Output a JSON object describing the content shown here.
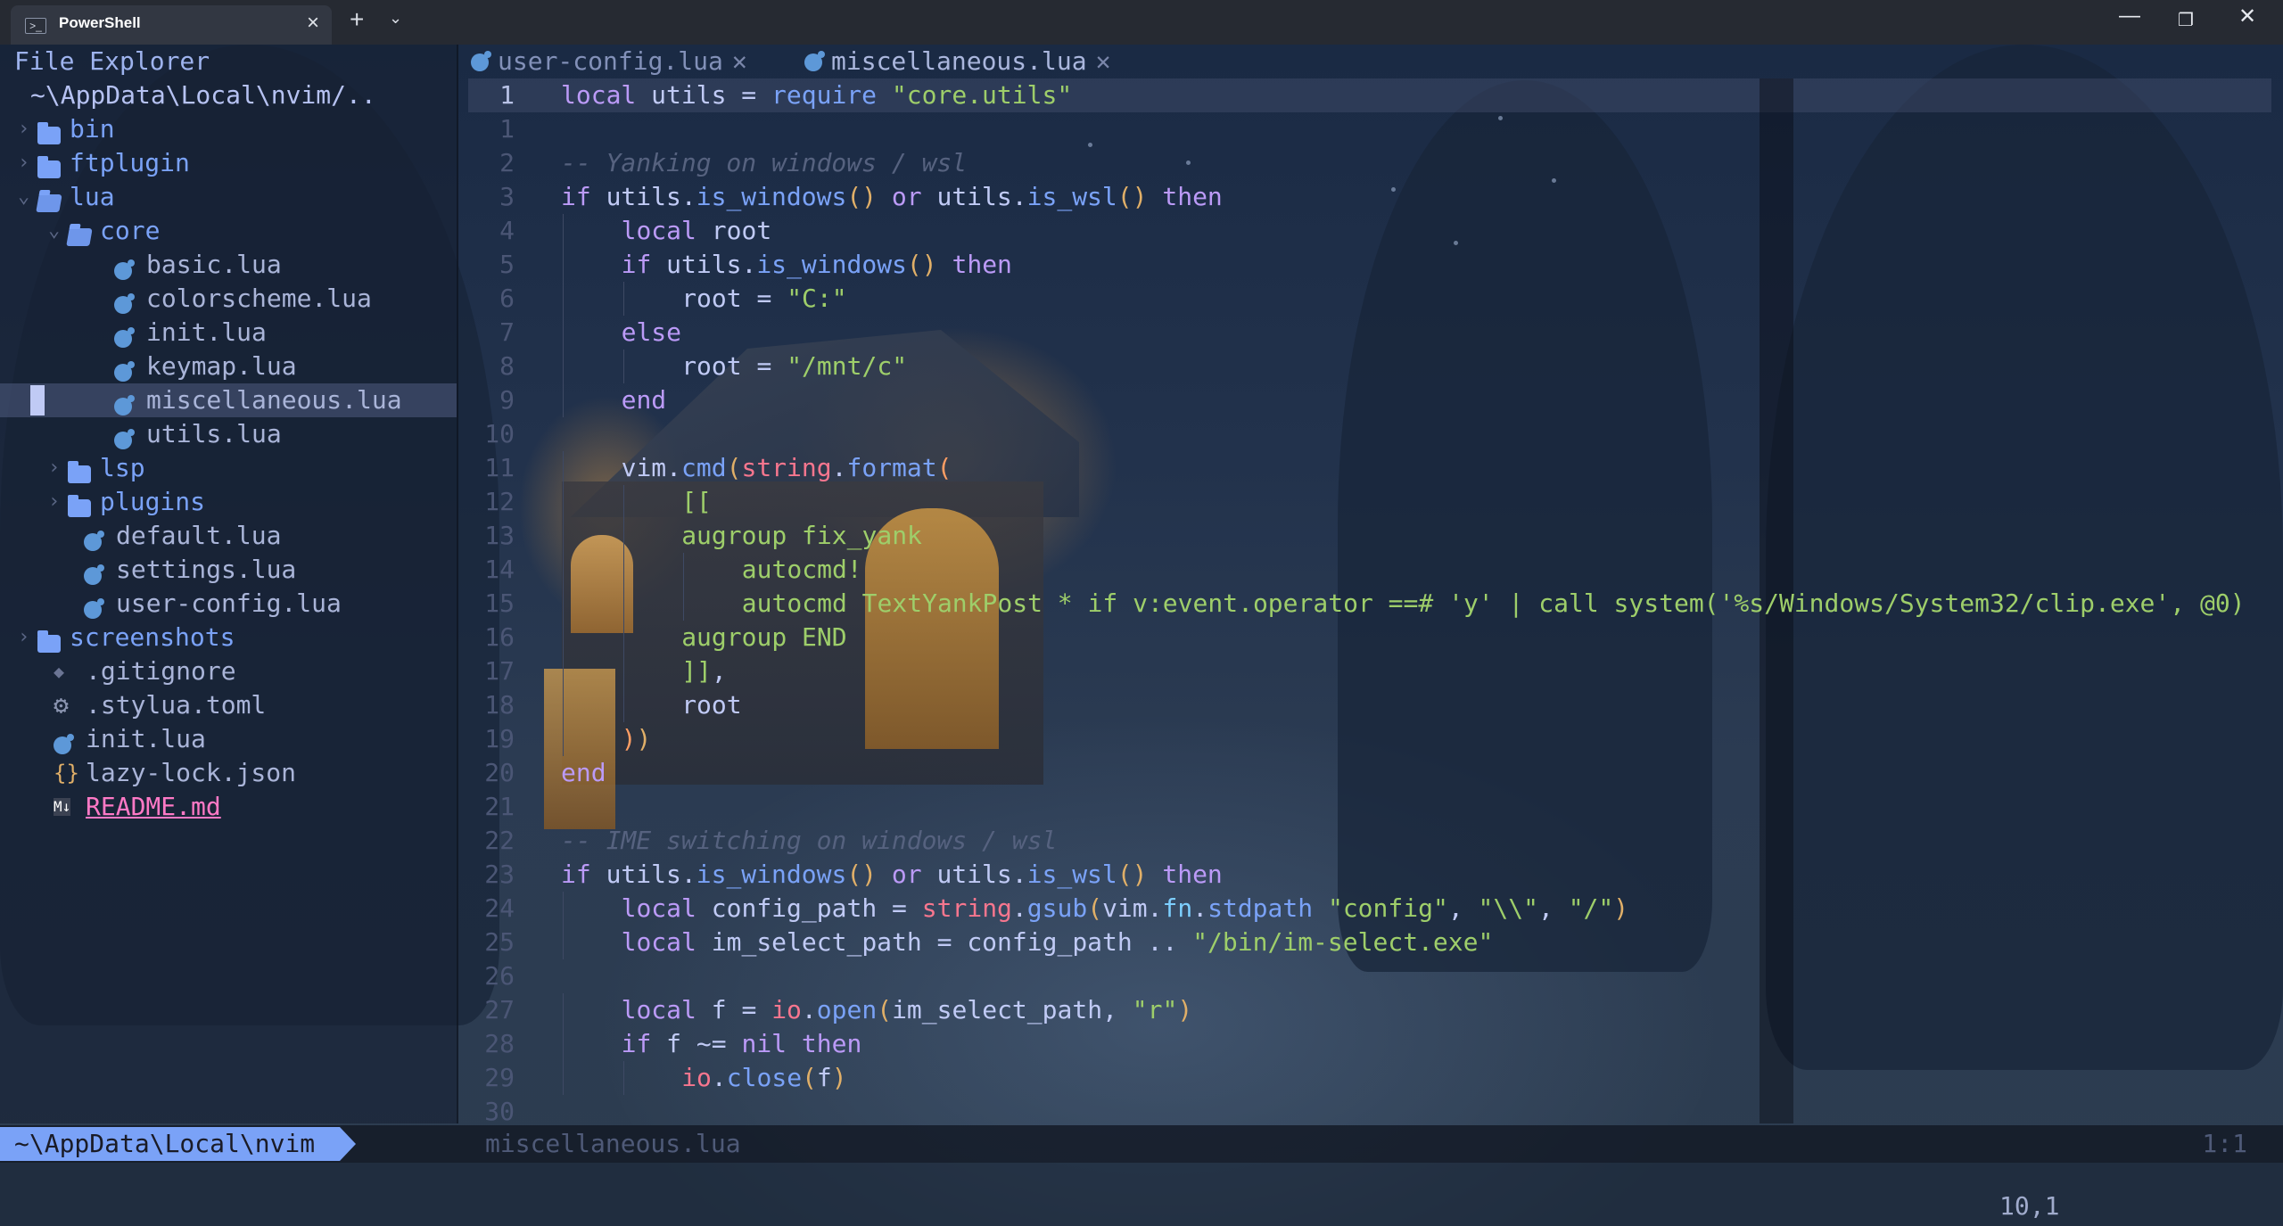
{
  "window": {
    "tab_title": "PowerShell",
    "tab_icon": "powershell-icon",
    "new_tab_label": "+",
    "dropdown_label": "⌄",
    "minimize_label": "—",
    "maximize_label": "❐",
    "close_label": "✕"
  },
  "explorer": {
    "title": "File Explorer",
    "root_path": "~\\AppData\\Local\\nvim/..",
    "items": [
      {
        "label": "bin",
        "type": "folder",
        "expanded": false,
        "depth": 0
      },
      {
        "label": "ftplugin",
        "type": "folder",
        "expanded": false,
        "depth": 0
      },
      {
        "label": "lua",
        "type": "folder",
        "expanded": true,
        "depth": 0
      },
      {
        "label": "core",
        "type": "folder",
        "expanded": true,
        "depth": 1
      },
      {
        "label": "basic.lua",
        "type": "lua",
        "depth": 2
      },
      {
        "label": "colorscheme.lua",
        "type": "lua",
        "depth": 2
      },
      {
        "label": "init.lua",
        "type": "lua",
        "depth": 2
      },
      {
        "label": "keymap.lua",
        "type": "lua",
        "depth": 2
      },
      {
        "label": "miscellaneous.lua",
        "type": "lua",
        "depth": 2,
        "selected": true
      },
      {
        "label": "utils.lua",
        "type": "lua",
        "depth": 2
      },
      {
        "label": "lsp",
        "type": "folder",
        "expanded": false,
        "depth": 1
      },
      {
        "label": "plugins",
        "type": "folder",
        "expanded": false,
        "depth": 1
      },
      {
        "label": "default.lua",
        "type": "lua",
        "depth": 1
      },
      {
        "label": "settings.lua",
        "type": "lua",
        "depth": 1
      },
      {
        "label": "user-config.lua",
        "type": "lua",
        "depth": 1
      },
      {
        "label": "screenshots",
        "type": "folder",
        "expanded": false,
        "depth": 0
      },
      {
        "label": ".gitignore",
        "type": "git",
        "depth": 0
      },
      {
        "label": ".stylua.toml",
        "type": "gear",
        "depth": 0
      },
      {
        "label": "init.lua",
        "type": "lua",
        "depth": 0
      },
      {
        "label": "lazy-lock.json",
        "type": "json",
        "depth": 0
      },
      {
        "label": "README.md",
        "type": "markdown",
        "depth": 0
      }
    ]
  },
  "editor": {
    "tabs": [
      {
        "label": "user-config.lua",
        "close": "✕",
        "active": false
      },
      {
        "label": "miscellaneous.lua",
        "close": "✕",
        "active": true
      }
    ],
    "current_line": 1,
    "lines": [
      {
        "n": "1",
        "indent": 0,
        "tokens": [
          [
            "kw",
            "local"
          ],
          [
            "pl",
            " utils = "
          ],
          [
            "fn",
            "require"
          ],
          [
            "pl",
            " "
          ],
          [
            "str",
            "\"core.utils\""
          ]
        ]
      },
      {
        "n": "1",
        "indent": 0,
        "tokens": []
      },
      {
        "n": "2",
        "indent": 0,
        "tokens": [
          [
            "cm",
            "-- Yanking on windows / wsl"
          ]
        ]
      },
      {
        "n": "3",
        "indent": 0,
        "tokens": [
          [
            "kw",
            "if"
          ],
          [
            "pl",
            " utils."
          ],
          [
            "fn",
            "is_windows"
          ],
          [
            "par",
            "()"
          ],
          [
            "pl",
            " "
          ],
          [
            "kw",
            "or"
          ],
          [
            "pl",
            " utils."
          ],
          [
            "fn",
            "is_wsl"
          ],
          [
            "par",
            "()"
          ],
          [
            "pl",
            " "
          ],
          [
            "kw",
            "then"
          ]
        ]
      },
      {
        "n": "4",
        "indent": 1,
        "tokens": [
          [
            "kw",
            "local"
          ],
          [
            "pl",
            " root"
          ]
        ]
      },
      {
        "n": "5",
        "indent": 1,
        "tokens": [
          [
            "kw",
            "if"
          ],
          [
            "pl",
            " utils."
          ],
          [
            "fn",
            "is_windows"
          ],
          [
            "par",
            "()"
          ],
          [
            "pl",
            " "
          ],
          [
            "kw",
            "then"
          ]
        ]
      },
      {
        "n": "6",
        "indent": 2,
        "tokens": [
          [
            "pl",
            "root = "
          ],
          [
            "str",
            "\"C:\""
          ]
        ]
      },
      {
        "n": "7",
        "indent": 1,
        "tokens": [
          [
            "kw",
            "else"
          ]
        ]
      },
      {
        "n": "8",
        "indent": 2,
        "tokens": [
          [
            "pl",
            "root = "
          ],
          [
            "str",
            "\"/mnt/c\""
          ]
        ]
      },
      {
        "n": "9",
        "indent": 1,
        "tokens": [
          [
            "kw",
            "end"
          ]
        ]
      },
      {
        "n": "10",
        "indent": 0,
        "tokens": []
      },
      {
        "n": "11",
        "indent": 1,
        "tokens": [
          [
            "pl",
            "vim."
          ],
          [
            "fn",
            "cmd"
          ],
          [
            "par",
            "("
          ],
          [
            "lib",
            "string"
          ],
          [
            "pl",
            "."
          ],
          [
            "fn",
            "format"
          ],
          [
            "par2",
            "("
          ]
        ]
      },
      {
        "n": "12",
        "indent": 2,
        "tokens": [
          [
            "str",
            "[["
          ]
        ]
      },
      {
        "n": "13",
        "indent": 2,
        "tokens": [
          [
            "str",
            "augroup fix_yank"
          ]
        ]
      },
      {
        "n": "14",
        "indent": 3,
        "tokens": [
          [
            "str",
            "autocmd!"
          ]
        ]
      },
      {
        "n": "15",
        "indent": 3,
        "tokens": [
          [
            "str",
            "autocmd TextYankPost * if v:event.operator ==# 'y' | call system('%s/Windows/System32/clip.exe', @0)"
          ]
        ]
      },
      {
        "n": "16",
        "indent": 2,
        "tokens": [
          [
            "str",
            "augroup END"
          ]
        ]
      },
      {
        "n": "17",
        "indent": 2,
        "tokens": [
          [
            "str",
            "]]"
          ],
          [
            "pl",
            ","
          ]
        ]
      },
      {
        "n": "18",
        "indent": 2,
        "tokens": [
          [
            "pl",
            "root"
          ]
        ]
      },
      {
        "n": "19",
        "indent": 1,
        "tokens": [
          [
            "par2",
            ")"
          ],
          [
            "par",
            ")"
          ]
        ]
      },
      {
        "n": "20",
        "indent": 0,
        "tokens": [
          [
            "kw",
            "end"
          ]
        ]
      },
      {
        "n": "21",
        "indent": 0,
        "tokens": []
      },
      {
        "n": "22",
        "indent": 0,
        "tokens": [
          [
            "cm",
            "-- IME switching on windows / wsl"
          ]
        ]
      },
      {
        "n": "23",
        "indent": 0,
        "tokens": [
          [
            "kw",
            "if"
          ],
          [
            "pl",
            " utils."
          ],
          [
            "fn",
            "is_windows"
          ],
          [
            "par",
            "()"
          ],
          [
            "pl",
            " "
          ],
          [
            "kw",
            "or"
          ],
          [
            "pl",
            " utils."
          ],
          [
            "fn",
            "is_wsl"
          ],
          [
            "par",
            "()"
          ],
          [
            "pl",
            " "
          ],
          [
            "kw",
            "then"
          ]
        ]
      },
      {
        "n": "24",
        "indent": 1,
        "tokens": [
          [
            "kw",
            "local"
          ],
          [
            "pl",
            " config_path = "
          ],
          [
            "lib",
            "string"
          ],
          [
            "pl",
            "."
          ],
          [
            "fn",
            "gsub"
          ],
          [
            "par",
            "("
          ],
          [
            "pl",
            "vim."
          ],
          [
            "vim",
            "fn"
          ],
          [
            "pl",
            "."
          ],
          [
            "fn",
            "stdpath"
          ],
          [
            "pl",
            " "
          ],
          [
            "str",
            "\"config\""
          ],
          [
            "pl",
            ", "
          ],
          [
            "str",
            "\"\\\\\""
          ],
          [
            "pl",
            ", "
          ],
          [
            "str",
            "\"/\""
          ],
          [
            "par",
            ")"
          ]
        ]
      },
      {
        "n": "25",
        "indent": 1,
        "tokens": [
          [
            "kw",
            "local"
          ],
          [
            "pl",
            " im_select_path = config_path .. "
          ],
          [
            "str",
            "\"/bin/im-select.exe\""
          ]
        ]
      },
      {
        "n": "26",
        "indent": 0,
        "tokens": []
      },
      {
        "n": "27",
        "indent": 1,
        "tokens": [
          [
            "kw",
            "local"
          ],
          [
            "pl",
            " f = "
          ],
          [
            "lib",
            "io"
          ],
          [
            "pl",
            "."
          ],
          [
            "fn",
            "open"
          ],
          [
            "par",
            "("
          ],
          [
            "pl",
            "im_select_path, "
          ],
          [
            "str",
            "\"r\""
          ],
          [
            "par",
            ")"
          ]
        ]
      },
      {
        "n": "28",
        "indent": 1,
        "tokens": [
          [
            "kw",
            "if"
          ],
          [
            "pl",
            " f ~= "
          ],
          [
            "kw",
            "nil"
          ],
          [
            "pl",
            " "
          ],
          [
            "kw",
            "then"
          ]
        ]
      },
      {
        "n": "29",
        "indent": 2,
        "tokens": [
          [
            "lib",
            "io"
          ],
          [
            "pl",
            "."
          ],
          [
            "fn",
            "close"
          ],
          [
            "par",
            "("
          ],
          [
            "pl",
            "f"
          ],
          [
            "par",
            ")"
          ]
        ]
      },
      {
        "n": "30",
        "indent": 0,
        "tokens": []
      }
    ]
  },
  "statusline": {
    "path": "~\\AppData\\Local\\nvim",
    "file": "miscellaneous.lua",
    "position": "1:1"
  },
  "cmdline": {
    "ruler": "10,1"
  },
  "colors": {
    "accent": "#7aa2f7",
    "keyword": "#bb9af7",
    "string": "#9ece6a",
    "comment": "#56627f",
    "library": "#f7768e",
    "paren": "#e0af68"
  }
}
